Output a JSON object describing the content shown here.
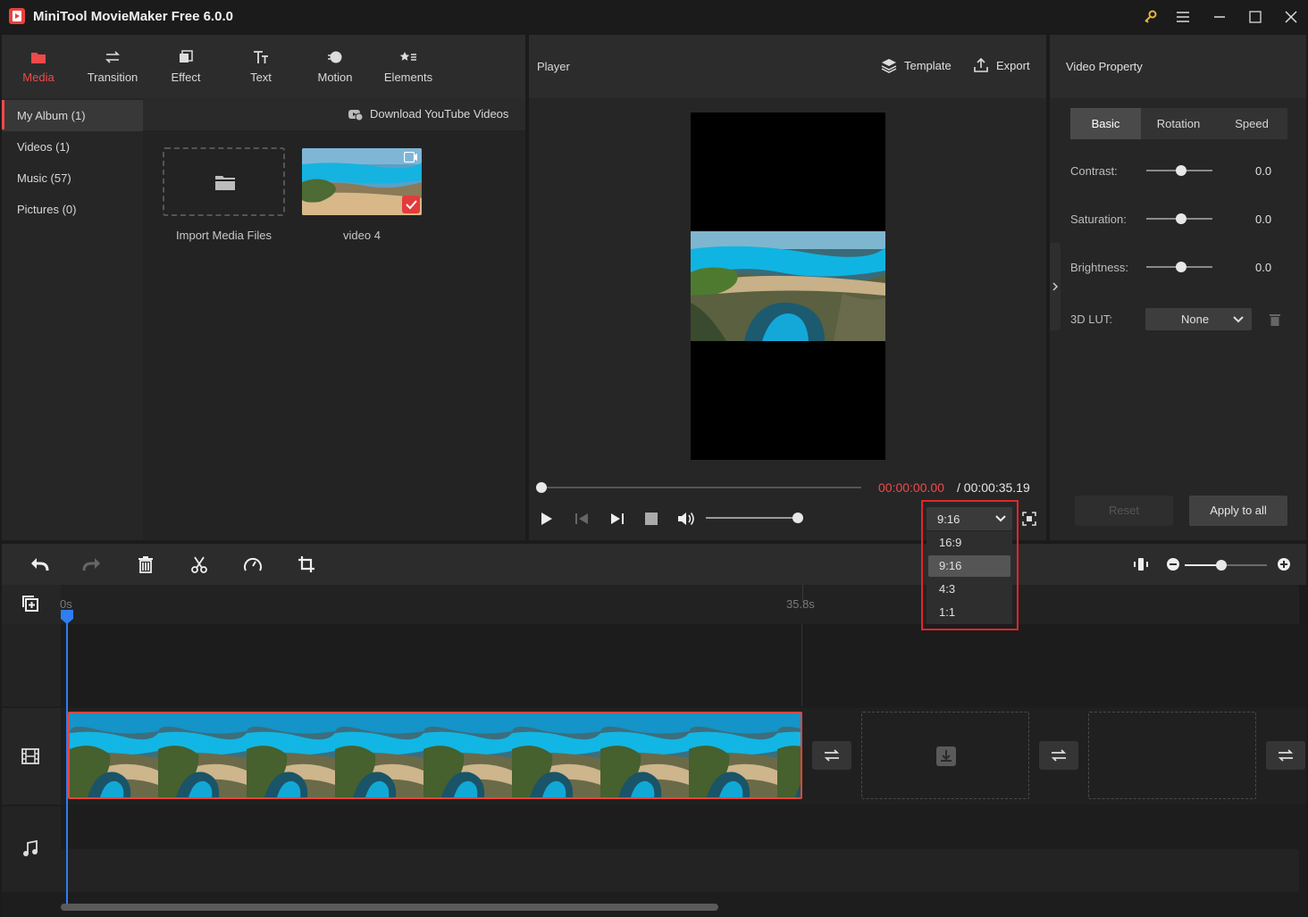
{
  "app": {
    "title": "MiniTool MovieMaker Free 6.0.0"
  },
  "toolbar": {
    "tabs": [
      "Media",
      "Transition",
      "Effect",
      "Text",
      "Motion",
      "Elements"
    ]
  },
  "album": {
    "items": [
      "My Album (1)",
      "Videos (1)",
      "Music (57)",
      "Pictures (0)"
    ],
    "download_label": "Download YouTube Videos",
    "import_label": "Import Media Files",
    "video_label": "video 4"
  },
  "player": {
    "title": "Player",
    "template_label": "Template",
    "export_label": "Export",
    "current_time": "00:00:00.00",
    "total_time": "/ 00:00:35.19",
    "progress": 0,
    "volume": 1.0,
    "aspect": {
      "selected": "9:16",
      "options": [
        "16:9",
        "9:16",
        "4:3",
        "1:1"
      ]
    }
  },
  "property": {
    "title": "Video Property",
    "tabs": [
      "Basic",
      "Rotation",
      "Speed"
    ],
    "contrast": {
      "label": "Contrast:",
      "value": "0.0"
    },
    "saturation": {
      "label": "Saturation:",
      "value": "0.0"
    },
    "brightness": {
      "label": "Brightness:",
      "value": "0.0"
    },
    "lut": {
      "label": "3D LUT:",
      "value": "None"
    },
    "reset_label": "Reset",
    "apply_label": "Apply to all"
  },
  "timeline": {
    "ruler_start": "0s",
    "ruler_end": "35.8s"
  },
  "colors": {
    "accent": "#ef4a4a",
    "highlight": "#e0262c"
  }
}
